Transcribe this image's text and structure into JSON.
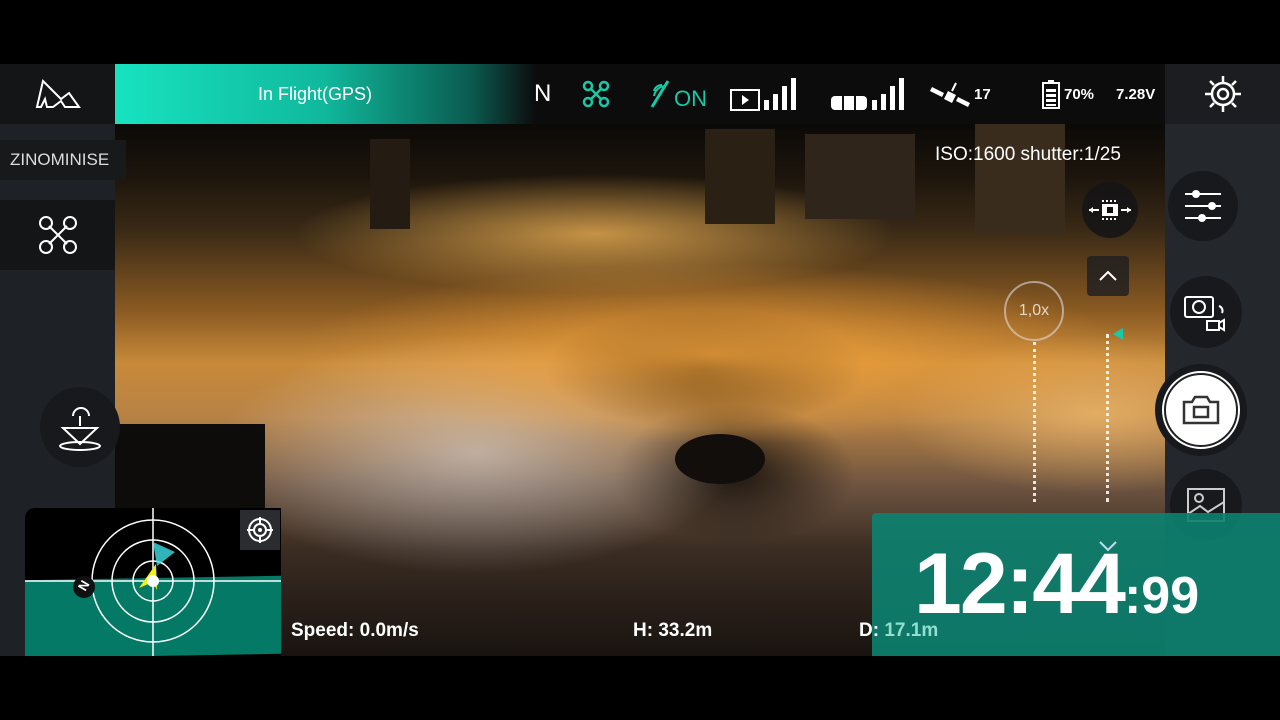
{
  "topbar": {
    "status": "In Flight(GPS)",
    "compass": "N",
    "obstacle_label": "ON",
    "satellites": "17",
    "battery_percent": "70%",
    "voltage": "7.28V",
    "video_signal_bars": 5,
    "rc_signal_bars": 5,
    "accent": "#17e3c0"
  },
  "sidebar": {
    "mode_label": "ZINOMINISE"
  },
  "camera": {
    "exposure": "ISO:1600 shutter:1/25",
    "zoom": "1,0x"
  },
  "telemetry": {
    "speed_label": "Speed:",
    "speed_value": "0.0m/s",
    "height_label": "H:",
    "height_value": "33.2m",
    "distance_label": "D:",
    "distance_value": "17.1m"
  },
  "timer": {
    "main": "12:44",
    "fraction": ":99"
  },
  "map": {
    "north_label": "N"
  }
}
